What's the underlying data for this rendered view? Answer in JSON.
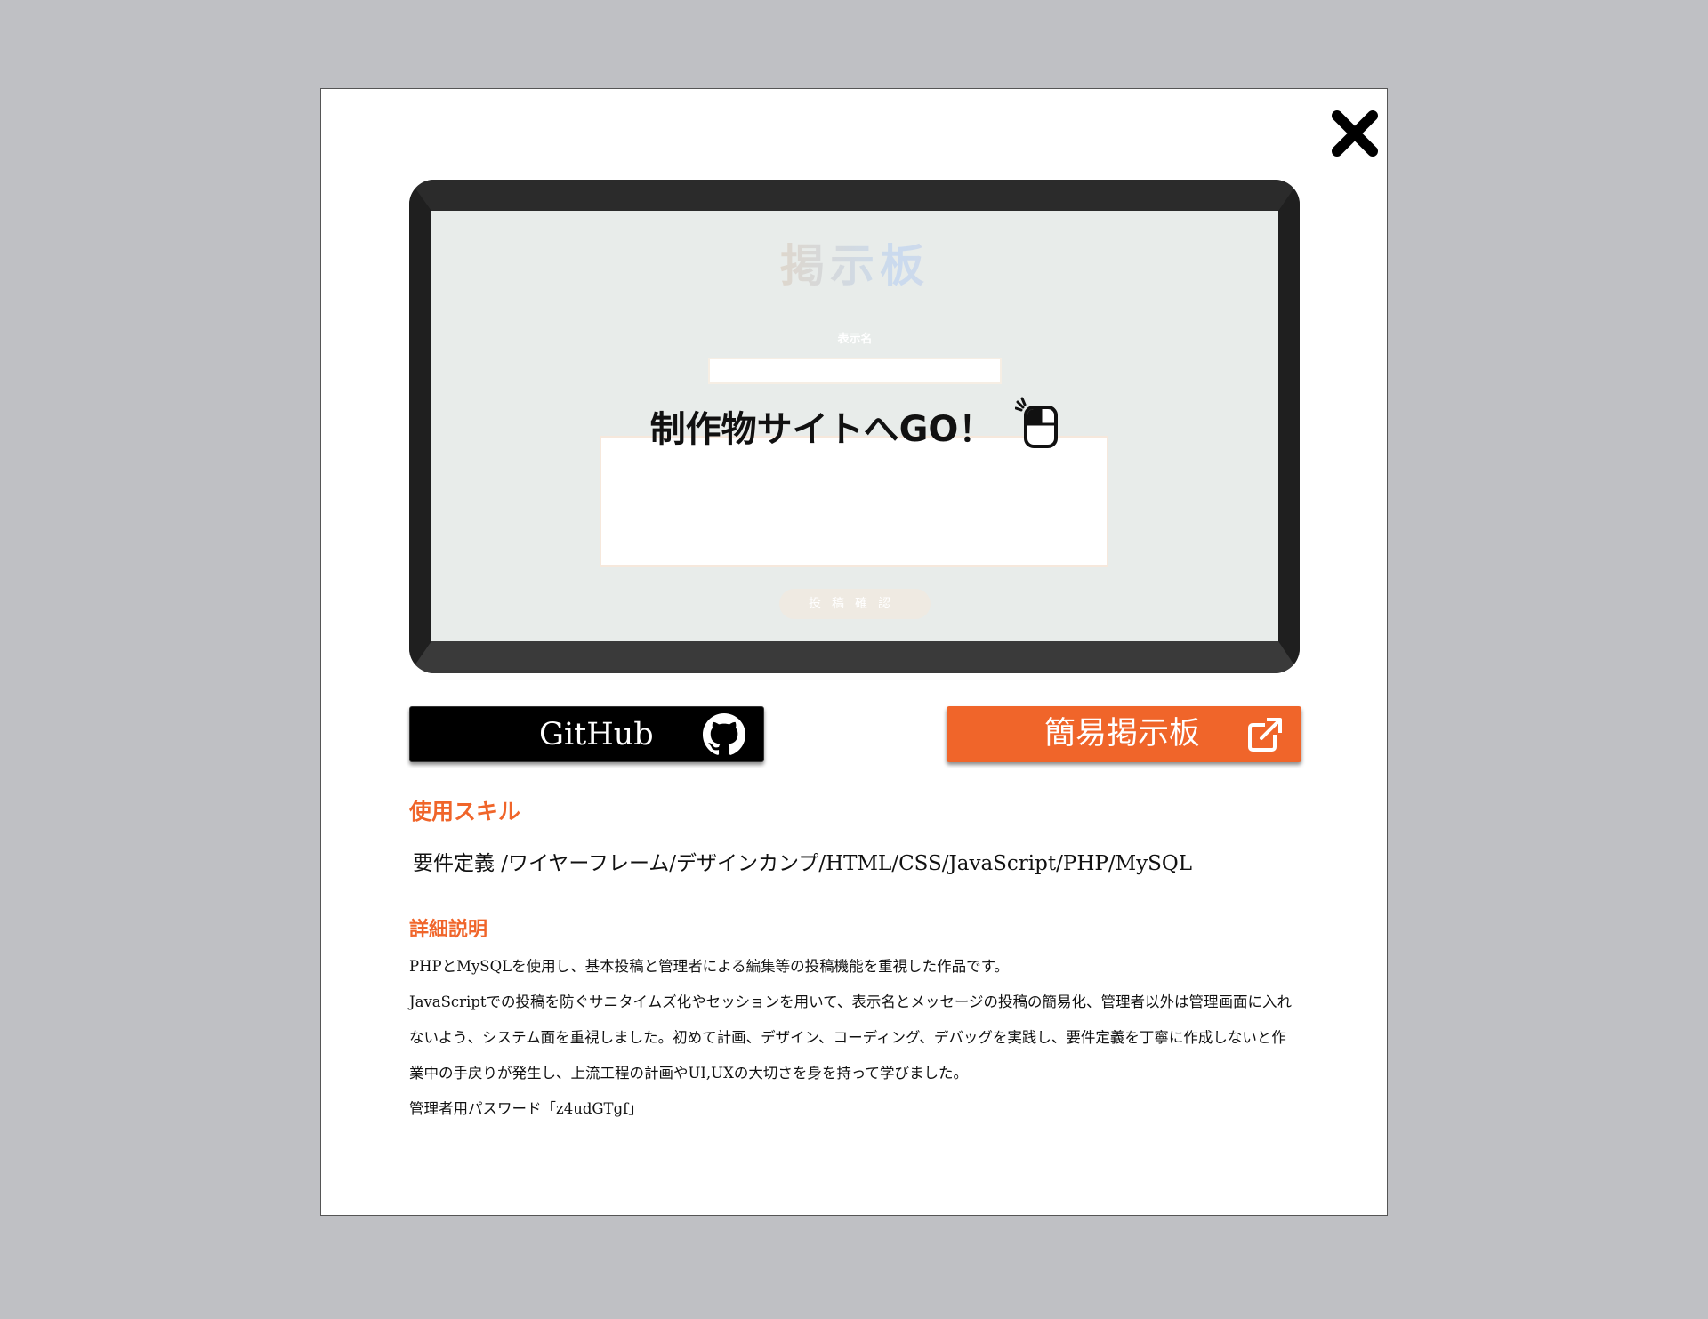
{
  "modal": {
    "close_icon": "close-x-icon",
    "preview": {
      "title": "掲示板",
      "name_label": "表示名",
      "submit_label": "投稿確認",
      "overlay_text": "制作物サイトへGO！",
      "overlay_icon": "mouse-click-icon"
    },
    "buttons": {
      "github_label": "GitHub",
      "github_icon": "github-icon",
      "site_label": "簡易掲示板",
      "site_icon": "external-link-icon"
    },
    "skills": {
      "heading": "使用スキル",
      "text": "要件定義 /ワイヤーフレーム/デザインカンプ/HTML/CSS/JavaScript/PHP/MySQL"
    },
    "detail": {
      "heading": "詳細説明",
      "line1": "PHPとMySQLを使用し、基本投稿と管理者による編集等の投稿機能を重視した作品です。",
      "line2": "JavaScriptでの投稿を防ぐサニタイムズ化やセッションを用いて、表示名とメッセージの投稿の簡易化、管理者以外は管理画面に入れないよう、システム面を重視しました。初めて計画、デザイン、コーディング、デバッグを実践し、要件定義を丁寧に作成しないと作業中の手戻りが発生し、上流工程の計画やUI,UXの大切さを身を持って学びました。",
      "line3": "管理者用パスワード「z4udGTgf」"
    },
    "colors": {
      "accent": "#f0652a",
      "github_bg": "#000000",
      "backdrop": "#bfc0c4"
    }
  }
}
